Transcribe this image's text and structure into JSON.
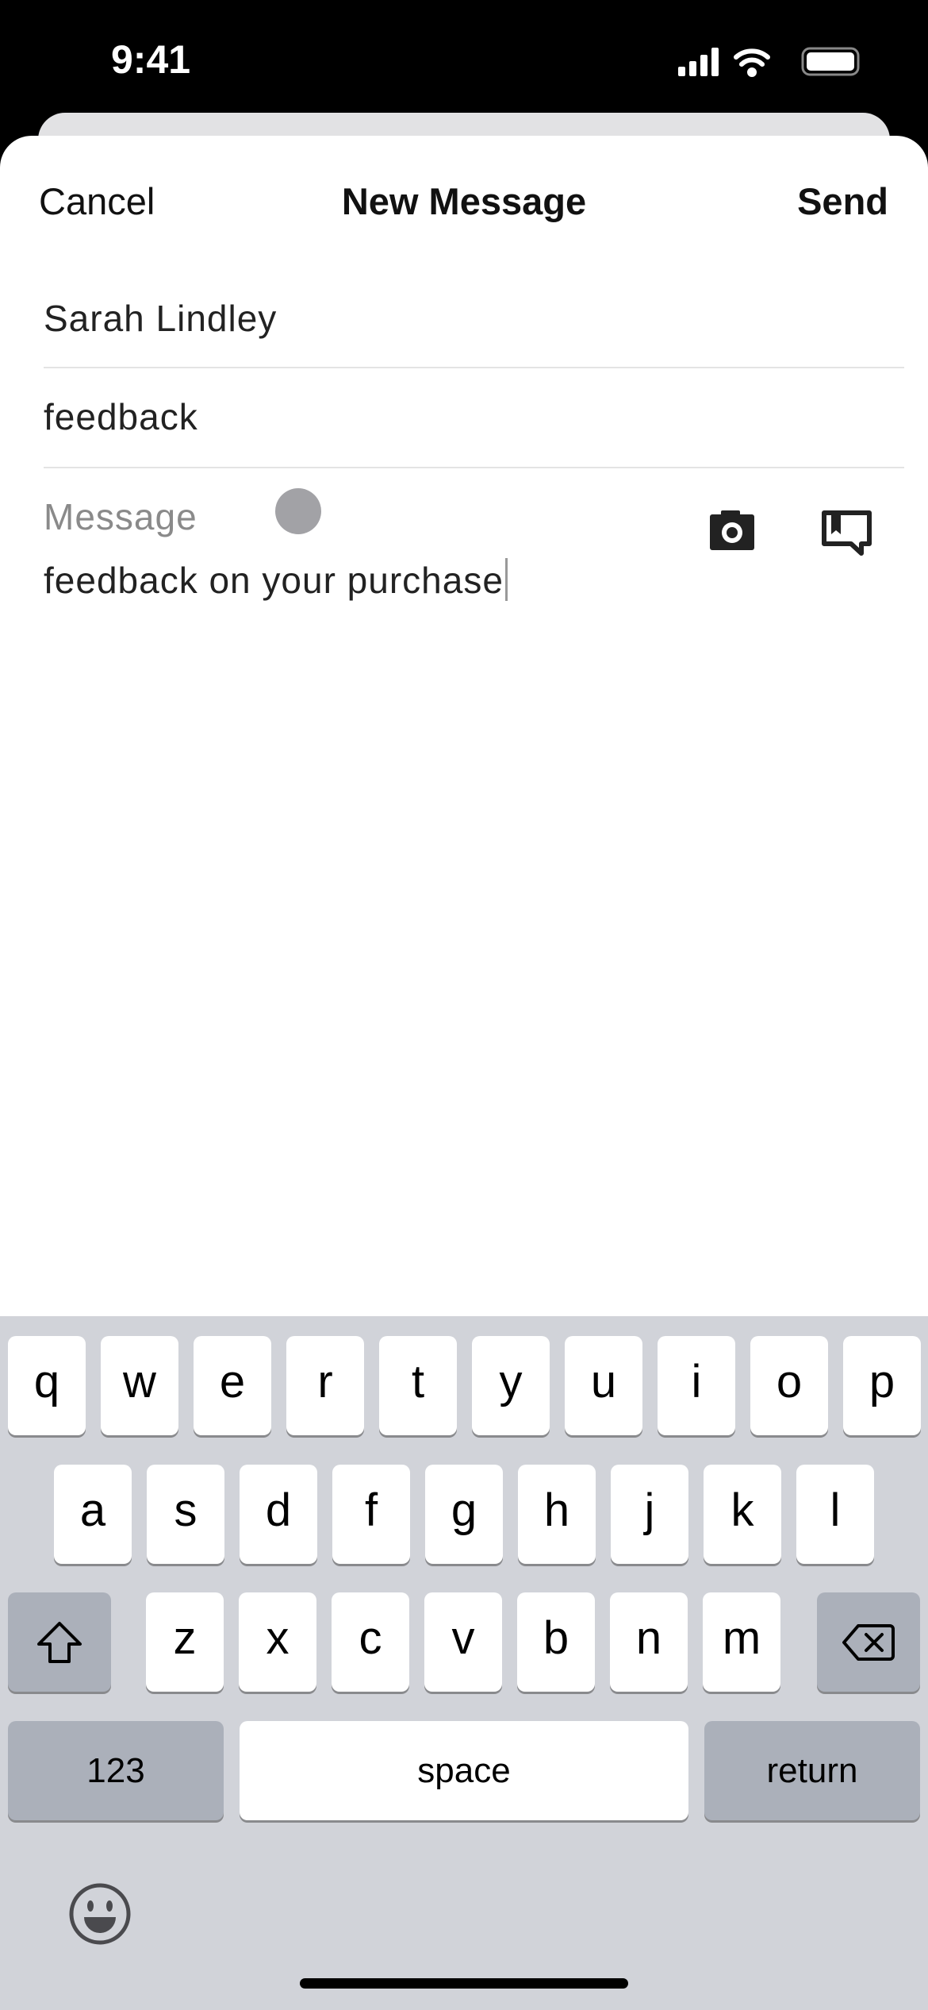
{
  "status_bar": {
    "time": "9:41"
  },
  "nav": {
    "cancel": "Cancel",
    "title": "New Message",
    "send": "Send"
  },
  "form": {
    "recipient": "Sarah Lindley",
    "subject": "feedback",
    "message_placeholder": "Message",
    "message_value": "feedback on your purchase"
  },
  "icons": {
    "camera": "camera-icon",
    "saved_replies": "bookmark-speech-bubble-icon"
  },
  "keyboard": {
    "row1": [
      "q",
      "w",
      "e",
      "r",
      "t",
      "y",
      "u",
      "i",
      "o",
      "p"
    ],
    "row2": [
      "a",
      "s",
      "d",
      "f",
      "g",
      "h",
      "j",
      "k",
      "l"
    ],
    "row3": [
      "z",
      "x",
      "c",
      "v",
      "b",
      "n",
      "m"
    ],
    "numbers": "123",
    "space": "space",
    "return": "return"
  }
}
